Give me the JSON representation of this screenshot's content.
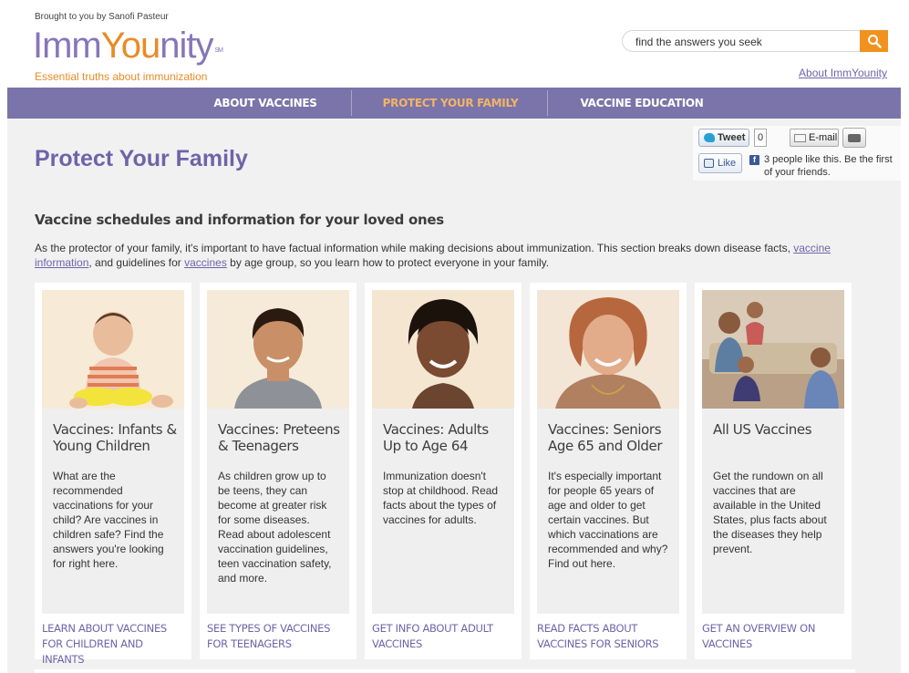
{
  "header": {
    "brought_by": "Brought to you by Sanofi Pasteur",
    "logo": {
      "part1": "Imm",
      "part2": "You",
      "part3": "nity",
      "mark": "SM"
    },
    "tagline": "Essential truths about immunization",
    "search": {
      "value": "find the answers you seek",
      "button_icon": "search-icon"
    },
    "about_link": "About ImmYounity"
  },
  "nav": {
    "items": [
      {
        "label": "ABOUT VACCINES",
        "active": false
      },
      {
        "label": "PROTECT YOUR FAMILY",
        "active": true
      },
      {
        "label": "VACCINE EDUCATION",
        "active": false
      }
    ]
  },
  "page": {
    "title": "Protect Your Family",
    "section_heading": "Vaccine schedules and information for your loved ones",
    "intro": {
      "part1": "As the protector of your family, it's important to have factual information while making decisions about immunization. This section breaks down disease facts, ",
      "link1": "vaccine information",
      "part2": ", and guidelines for ",
      "link2": "vaccines",
      "part3": " by age group, so you learn how to protect everyone in your family."
    }
  },
  "social": {
    "tweet_label": "Tweet",
    "tweet_count": "0",
    "email_label": "E-mail",
    "like_label": "Like",
    "like_text": "3 people like this. Be the first of your friends."
  },
  "cards": [
    {
      "title": "Vaccines: Infants & Young Children",
      "desc": "What are the recommended vaccinations for your child? Are vaccines in children safe? Find the answers you're looking for right here.",
      "link": "LEARN ABOUT VACCINES FOR CHILDREN AND INFANTS",
      "photo": "infant-photo"
    },
    {
      "title": "Vaccines: Preteens & Teenagers",
      "desc": "As children grow up to be teens, they can become at greater risk for some diseases. Read about adolescent vaccination guidelines, teen vaccination safety, and more.",
      "link": "SEE TYPES OF VACCINES FOR TEENAGERS",
      "photo": "teen-photo"
    },
    {
      "title": "Vaccines: Adults Up to Age 64",
      "desc": "Immunization doesn't stop at childhood. Read facts about the types of vaccines for adults.",
      "link": "GET INFO ABOUT ADULT VACCINES",
      "photo": "adult-photo"
    },
    {
      "title": "Vaccines: Seniors Age 65 and Older",
      "desc": "It's especially important for people 65 years of age and older to get certain vaccines. But which vaccinations are recommended and why? Find out here.",
      "link": "READ FACTS ABOUT VACCINES FOR SENIORS",
      "photo": "senior-photo"
    },
    {
      "title": "All US Vaccines",
      "desc": "Get the rundown on all vaccines that are available in the United States, plus facts about the diseases they help prevent.",
      "link": "GET AN OVERVIEW ON VACCINES",
      "photo": "family-photo"
    }
  ],
  "colors": {
    "brand_purple": "#7a74aa",
    "accent_orange": "#e98b26",
    "link_purple": "#6e64a8",
    "background_grey": "#f1f1f1"
  }
}
